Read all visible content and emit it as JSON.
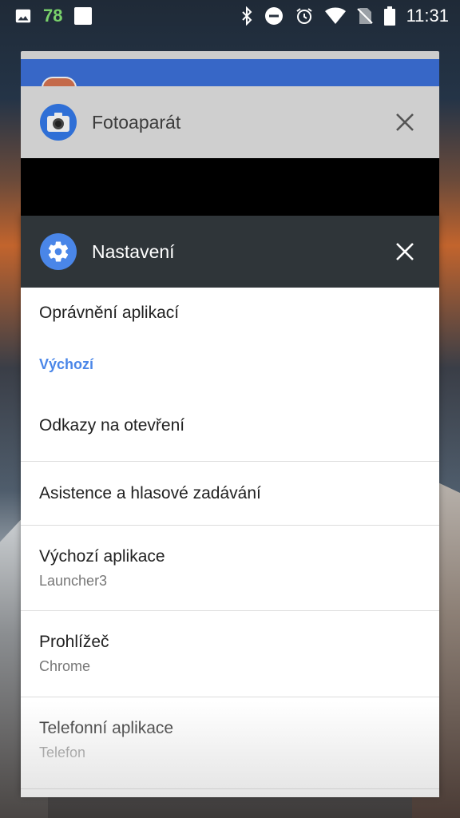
{
  "status_bar": {
    "notification_count": "78",
    "time": "11:31",
    "icons": [
      "image-icon",
      "square-icon",
      "bluetooth-icon",
      "do-not-disturb-icon",
      "alarm-icon",
      "wifi-icon",
      "no-sim-icon",
      "battery-icon"
    ]
  },
  "recents": {
    "camera_card": {
      "title": "Fotoaparát",
      "icon": "camera-icon",
      "accent": "#3767c7"
    },
    "settings_card": {
      "title": "Nastavení",
      "icon": "gear-icon",
      "accent": "#4a86e8",
      "items": [
        {
          "title": "Oprávnění aplikací",
          "subtitle": ""
        },
        {
          "section": "Výchozí"
        },
        {
          "title": "Odkazy na otevření",
          "subtitle": ""
        },
        {
          "title": "Asistence a hlasové zadávání",
          "subtitle": ""
        },
        {
          "title": "Výchozí aplikace",
          "subtitle": "Launcher3"
        },
        {
          "title": "Prohlížeč",
          "subtitle": "Chrome"
        },
        {
          "title": "Telefonní aplikace",
          "subtitle": "Telefon"
        }
      ]
    }
  }
}
